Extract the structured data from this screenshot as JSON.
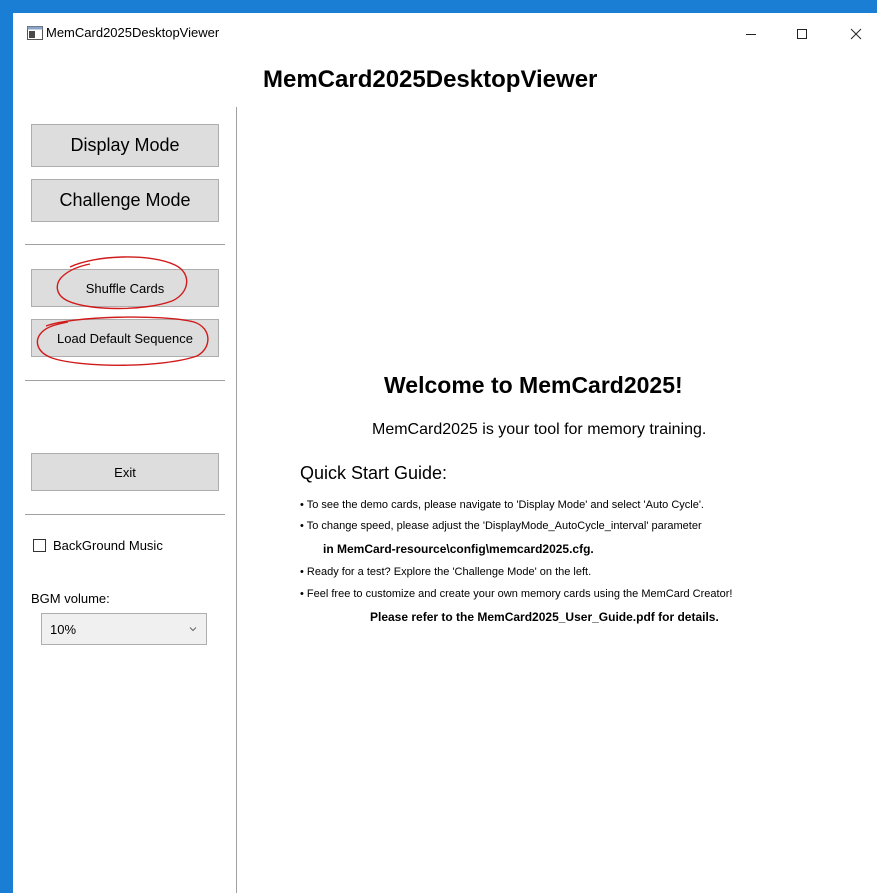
{
  "window": {
    "title": "MemCard2025DesktopViewer",
    "frame_color": "#1a7fd4"
  },
  "header": {
    "title": "MemCard2025DesktopViewer"
  },
  "sidebar": {
    "display_mode": "Display Mode",
    "challenge_mode": "Challenge Mode",
    "shuffle_cards": "Shuffle Cards",
    "load_default": "Load Default Sequence",
    "exit": "Exit",
    "bgm_checkbox": "BackGround Music",
    "bgm_checked": false,
    "bgm_volume_label": "BGM volume:",
    "bgm_volume_value": "10%"
  },
  "main": {
    "welcome_title": "Welcome to MemCard2025!",
    "welcome_subtitle": "MemCard2025 is your tool for memory training.",
    "quick_start_heading": "Quick Start Guide:",
    "guide": [
      "• To see the demo cards, please navigate to 'Display Mode' and select 'Auto Cycle'.",
      "• To change speed, please adjust the 'DisplayMode_AutoCycle_interval' parameter",
      "in MemCard-resource\\config\\memcard2025.cfg.",
      "• Ready for a test? Explore the 'Challenge Mode' on the left.",
      "• Feel free to customize and create your own memory cards using the MemCard Creator!",
      "Please refer to the MemCard2025_User_Guide.pdf for details."
    ]
  },
  "annotation_color": "#d11a1a"
}
